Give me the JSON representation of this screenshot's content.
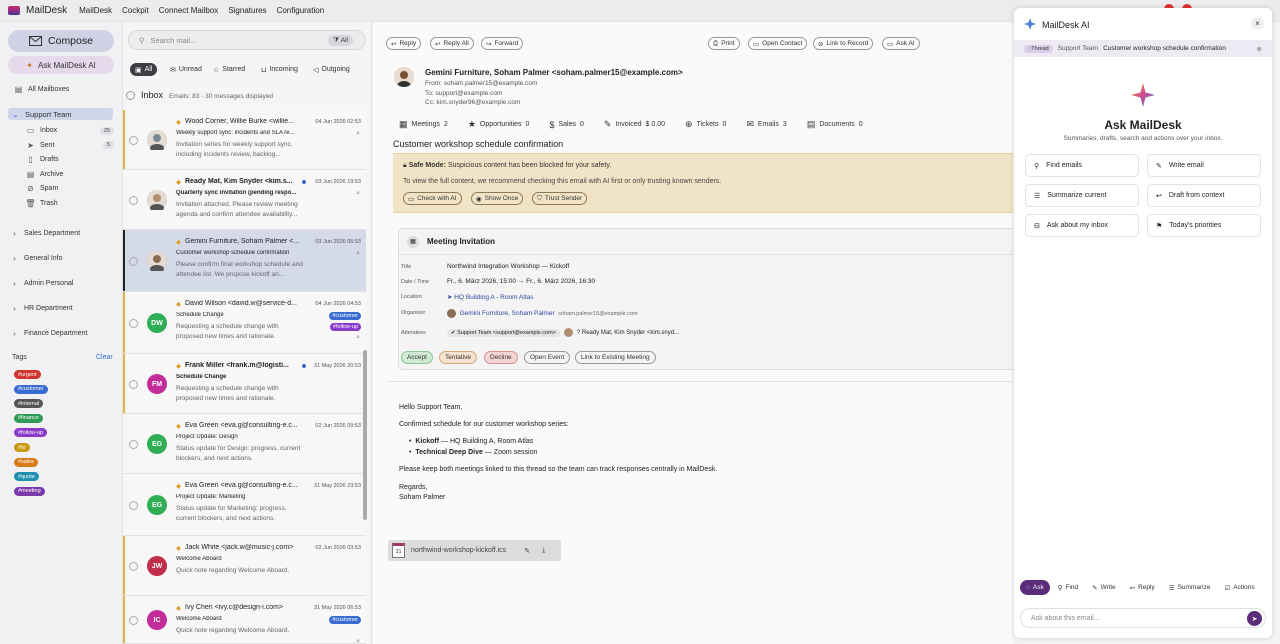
{
  "app": {
    "title": "MailDesk",
    "menu": [
      "MailDesk",
      "Cockpit",
      "Connect Mailbox",
      "Signatures",
      "Configuration"
    ]
  },
  "sidebar": {
    "compose": "Compose",
    "ask": "Ask MailDesk AI",
    "all": "All Mailboxes",
    "team": "Support Team",
    "folders": [
      {
        "label": "Inbox",
        "count": "25",
        "icon": "inbox-icon"
      },
      {
        "label": "Sent",
        "count": "5",
        "icon": "send-icon"
      },
      {
        "label": "Drafts",
        "count": "",
        "icon": "draft-icon"
      },
      {
        "label": "Archive",
        "count": "",
        "icon": "archive-icon"
      },
      {
        "label": "Spam",
        "count": "",
        "icon": "spam-icon"
      },
      {
        "label": "Trash",
        "count": "",
        "icon": "trash-icon"
      }
    ],
    "departments": [
      "Sales Department",
      "General Info",
      "Admin Personal",
      "HR Department",
      "Finance Department"
    ],
    "tags_title": "Tags",
    "clear": "Clear",
    "tags": [
      {
        "label": "#urgent",
        "color": "#d0352f"
      },
      {
        "label": "#customer",
        "color": "#3a6bd1"
      },
      {
        "label": "#internal",
        "color": "#555555"
      },
      {
        "label": "#finance",
        "color": "#2f9a55"
      },
      {
        "label": "#follow-up",
        "color": "#8a3ac9"
      },
      {
        "label": "#hr",
        "color": "#c89a10"
      },
      {
        "label": "#sales",
        "color": "#d97a18"
      },
      {
        "label": "#quote",
        "color": "#1f8fb0"
      },
      {
        "label": "#meeting",
        "color": "#7a3aa8"
      }
    ]
  },
  "list": {
    "search_placeholder": "Search mail...",
    "all_btn": "All",
    "filters": [
      "All",
      "Unread",
      "Starred",
      "Incoming",
      "Outgoing"
    ],
    "inbox_title": "Inbox",
    "inbox_meta": "Emails: 83 · 30 messages displayed",
    "rows": [
      {
        "sender": "Wood Corner, Willie Burke <willie...",
        "date": "04 Jun 2026 02:53",
        "subject": "Weekly support sync: incidents and SLA re...",
        "preview": "Invitation series for weekly support sync, including incidents review, backlog...",
        "avatar": "photo",
        "color": "#7a8a9a",
        "bar": true,
        "clip": true,
        "tags": []
      },
      {
        "sender": "Ready Mat, Kim Snyder <kim.s...",
        "date": "03 Jun 2026 19:53",
        "subject": "Quarterly sync invitation (pending respo...",
        "preview": "Invitation attached. Please review meeting agenda and confirm attendee availability...",
        "avatar": "photo",
        "color": "#b09070",
        "bar": false,
        "clip": true,
        "tags": [],
        "bold": true,
        "dot": true
      },
      {
        "sender": "Gemini Furniture, Soham Palmer <...",
        "date": "03 Jun 2026 05:53",
        "subject": "Customer workshop schedule confirmation",
        "preview": "Please confirm final workshop schedule and attendee list. We propose kickoff an...",
        "avatar": "photo",
        "color": "#8a6a50",
        "bar": false,
        "clip": true,
        "tags": [],
        "sel": true
      },
      {
        "sender": "David Wilson <david.w@service-d...",
        "date": "04 Jun 2026 04:53",
        "subject": "Schedule Change",
        "preview": "Requesting a schedule change with proposed new times and rationale.",
        "avatar": "DW",
        "color": "#2fae55",
        "bar": true,
        "clip": true,
        "tags": [
          {
            "label": "#customer",
            "color": "#3a6bd1"
          },
          {
            "label": "#follow-up",
            "color": "#8a3ac9"
          }
        ]
      },
      {
        "sender": "Frank Miller <frank.m@logisti...",
        "date": "31 May 2026 20:53",
        "subject": "Schedule Change",
        "preview": "Requesting a schedule change with proposed new times and rationale.",
        "avatar": "FM",
        "color": "#c22d9a",
        "bar": true,
        "clip": false,
        "tags": [],
        "bold": true,
        "dot": true
      },
      {
        "sender": "Eva Green <eva.g@consulting-e.c...",
        "date": "02 Jun 2026 09:53",
        "subject": "Project Update: Design",
        "preview": "Status update for Design: progress, current blockers, and next actions.",
        "avatar": "EG",
        "color": "#2fae55",
        "bar": false,
        "clip": false,
        "tags": []
      },
      {
        "sender": "Eva Green <eva.g@consulting-e.c...",
        "date": "31 May 2026 23:53",
        "subject": "Project Update: Marketing",
        "preview": "Status update for Marketing: progress, current blockers, and next actions.",
        "avatar": "EG",
        "color": "#2fae55",
        "bar": false,
        "clip": false,
        "tags": []
      },
      {
        "sender": "Jack White <jack.w@music-j.com>",
        "date": "02 Jun 2026 03:53",
        "subject": "Welcome Aboard",
        "preview": "Quick note regarding Welcome Aboard.",
        "avatar": "JW",
        "color": "#c22d4a",
        "bar": true,
        "clip": false,
        "tags": []
      },
      {
        "sender": "Ivy Chen <ivy.c@design-i.com>",
        "date": "31 May 2026 06:53",
        "subject": "Welcome Aboard",
        "preview": "Quick note regarding Welcome Aboard.",
        "avatar": "IC",
        "color": "#c22d9a",
        "bar": true,
        "clip": true,
        "tags": [
          {
            "label": "#customer",
            "color": "#3a6bd1"
          }
        ]
      }
    ]
  },
  "reader": {
    "toolbar_left": [
      "Reply",
      "Reply All",
      "Forward"
    ],
    "toolbar_right": [
      "Print",
      "Open Contact",
      "Link to Record",
      "Ask AI"
    ],
    "from_header": "Gemini Furniture, Soham Palmer <soham.palmer15@example.com>",
    "from": "From: soham.palmer15@example.com",
    "to": "To: support@example.com",
    "cc": "Cc: kim.snyder96@example.com",
    "stats": [
      {
        "label": "Meetings",
        "value": "2"
      },
      {
        "label": "Opportunities",
        "value": "0"
      },
      {
        "label": "Sales",
        "value": "0"
      },
      {
        "label": "Invoiced",
        "value": "$ 0.00"
      },
      {
        "label": "Tickets",
        "value": "0"
      },
      {
        "label": "Emails",
        "value": "3"
      },
      {
        "label": "Documents",
        "value": "0"
      }
    ],
    "subject": "Customer workshop schedule confirmation",
    "safe_title": "Safe Mode:",
    "safe_text": "Suspicious content has been blocked for your safety.",
    "safe_line2": "To view the full content, we recommend checking this email with AI first or only trusting known senders.",
    "safe_btns": [
      "Check with AI",
      "Show Once",
      "Trust Sender"
    ],
    "meeting": {
      "title": "Meeting Invitation",
      "rows": [
        {
          "label": "Title",
          "value": "Northwind Integration Workshop — Kickoff"
        },
        {
          "label": "Date / Time",
          "value": "Fr., 6. März 2026, 15:00 → Fr., 6. März 2026, 16:30"
        },
        {
          "label": "Location",
          "value": "HQ Building A - Room Atlas"
        },
        {
          "label": "Organizer",
          "value": "Gemini Furniture, Soham Palmer"
        },
        {
          "label": "Attendees",
          "value": "Support Team <support@example.com>"
        }
      ],
      "organizer_email": "soham.palmer15@example.com",
      "attendee2": "Ready Mat, Kim Snyder <kim.snyd...",
      "btns": [
        "Accept",
        "Tentative",
        "Decline",
        "Open Event",
        "Link to Existing Meeting"
      ]
    },
    "body": {
      "greet": "Hello Support Team,",
      "intro": "Confirmed schedule for our customer workshop series:",
      "b1_bold": "Kickoff",
      "b1": " — HQ Building A, Room Atlas",
      "b2_bold": "Technical Deep Dive",
      "b2": " — Zoom session",
      "p2": "Please keep both meetings linked to this thread so the team can track responses centrally in MailDesk.",
      "regards": "Regards,",
      "sign": "Soham Palmer"
    },
    "attachment": "northwind-workshop-kickoff.ics",
    "attach_day": "31"
  },
  "ai": {
    "title": "MailDesk AI",
    "ctx_chip": "Thread",
    "ctx_team": "Support Team",
    "ctx_subject": "Customer workshop schedule confirmation",
    "heading": "Ask MailDesk",
    "sub": "Summaries, drafts, search and actions over your inbox.",
    "actions": [
      {
        "label": "Find emails",
        "icon": "search-icon"
      },
      {
        "label": "Write email",
        "icon": "pen-icon"
      },
      {
        "label": "Summarize current",
        "icon": "list-icon"
      },
      {
        "label": "Draft from context",
        "icon": "reply-icon"
      },
      {
        "label": "Ask about my inbox",
        "icon": "inbox-icon"
      },
      {
        "label": "Today's priorities",
        "icon": "flag-icon"
      }
    ],
    "modes": [
      "Ask",
      "Find",
      "Write",
      "Reply",
      "Summarize",
      "Actions"
    ],
    "input_placeholder": "Ask about this email..."
  }
}
